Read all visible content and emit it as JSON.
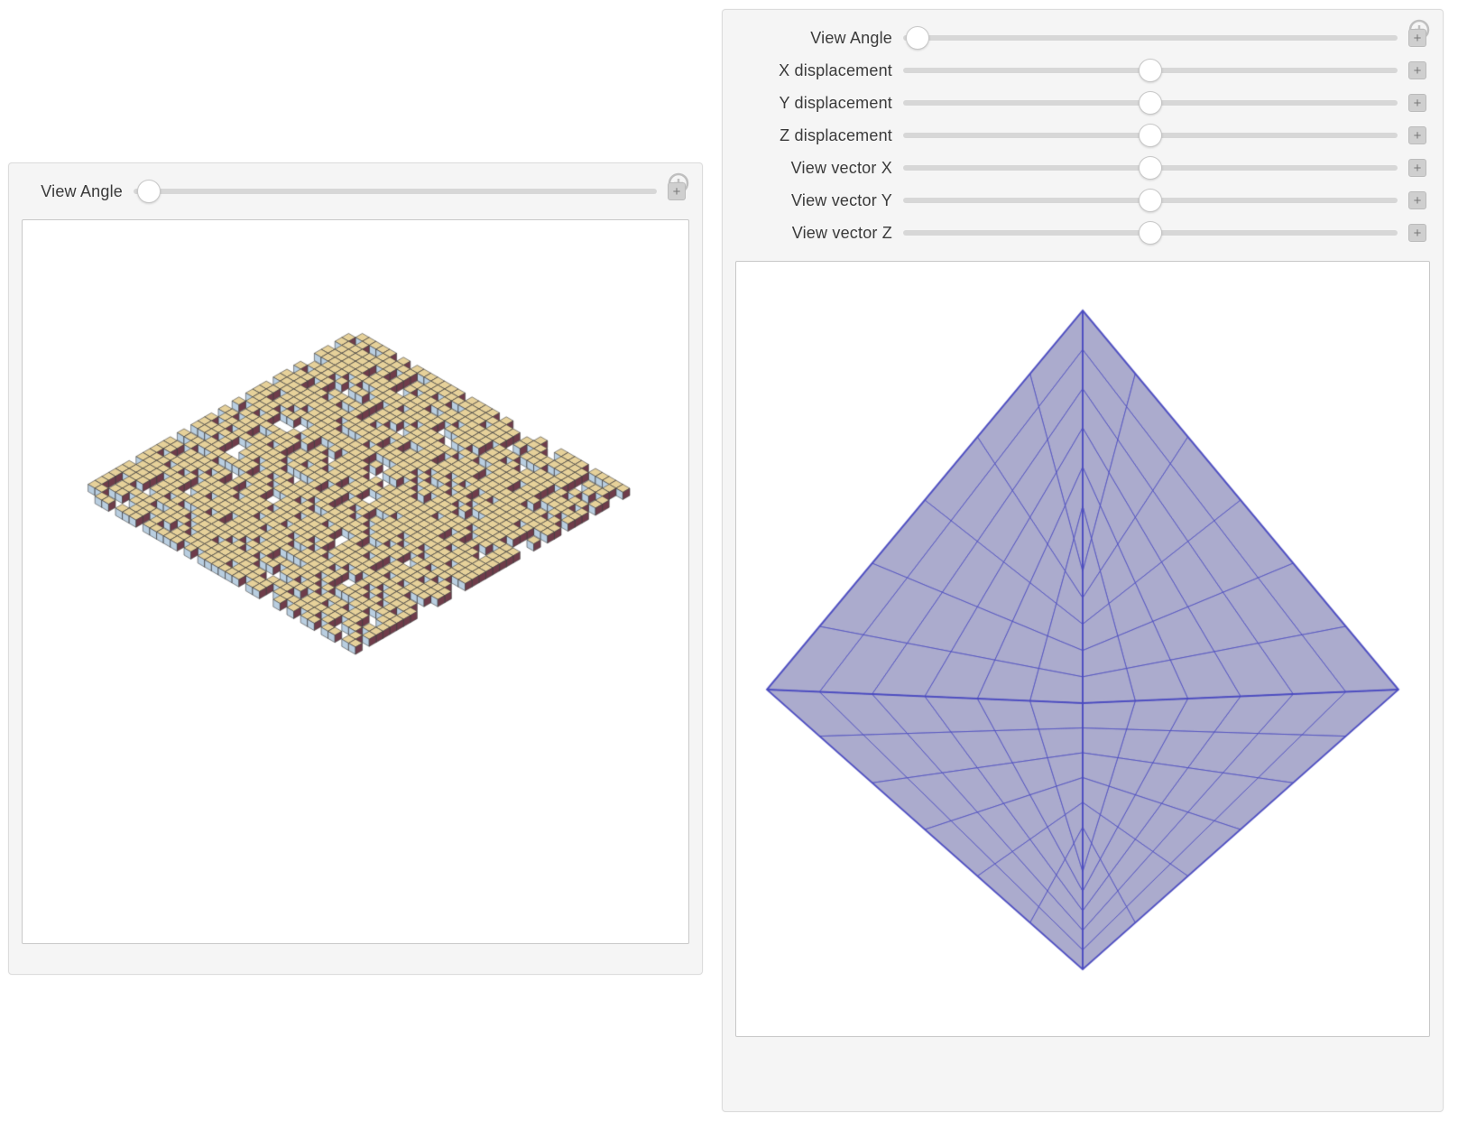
{
  "left_panel": {
    "controls": [
      {
        "label": "View Angle",
        "pos": 0.03
      }
    ],
    "graphic": {
      "type": "voxel-sheet-isometric",
      "colors": {
        "top": "#e6d19a",
        "left": "#b9cee0",
        "right": "#6f3c4a",
        "edge": "#3c3c3c"
      },
      "grid": 40
    }
  },
  "right_panel": {
    "controls": [
      {
        "label": "View Angle",
        "pos": 0.03
      },
      {
        "label": "X displacement",
        "pos": 0.5
      },
      {
        "label": "Y displacement",
        "pos": 0.5
      },
      {
        "label": "Z displacement",
        "pos": 0.5
      },
      {
        "label": "View vector X",
        "pos": 0.5
      },
      {
        "label": "View vector Y",
        "pos": 0.5
      },
      {
        "label": "View vector Z",
        "pos": 0.5
      }
    ],
    "graphic": {
      "type": "translucent-cube-perspective",
      "colors": {
        "warm": "#c68a6e",
        "cool": "#8787b8",
        "edge": "#4a4ac0"
      },
      "grid": 6
    }
  },
  "glyphs": {
    "plus": "+",
    "menu_desc": "options-menu"
  }
}
